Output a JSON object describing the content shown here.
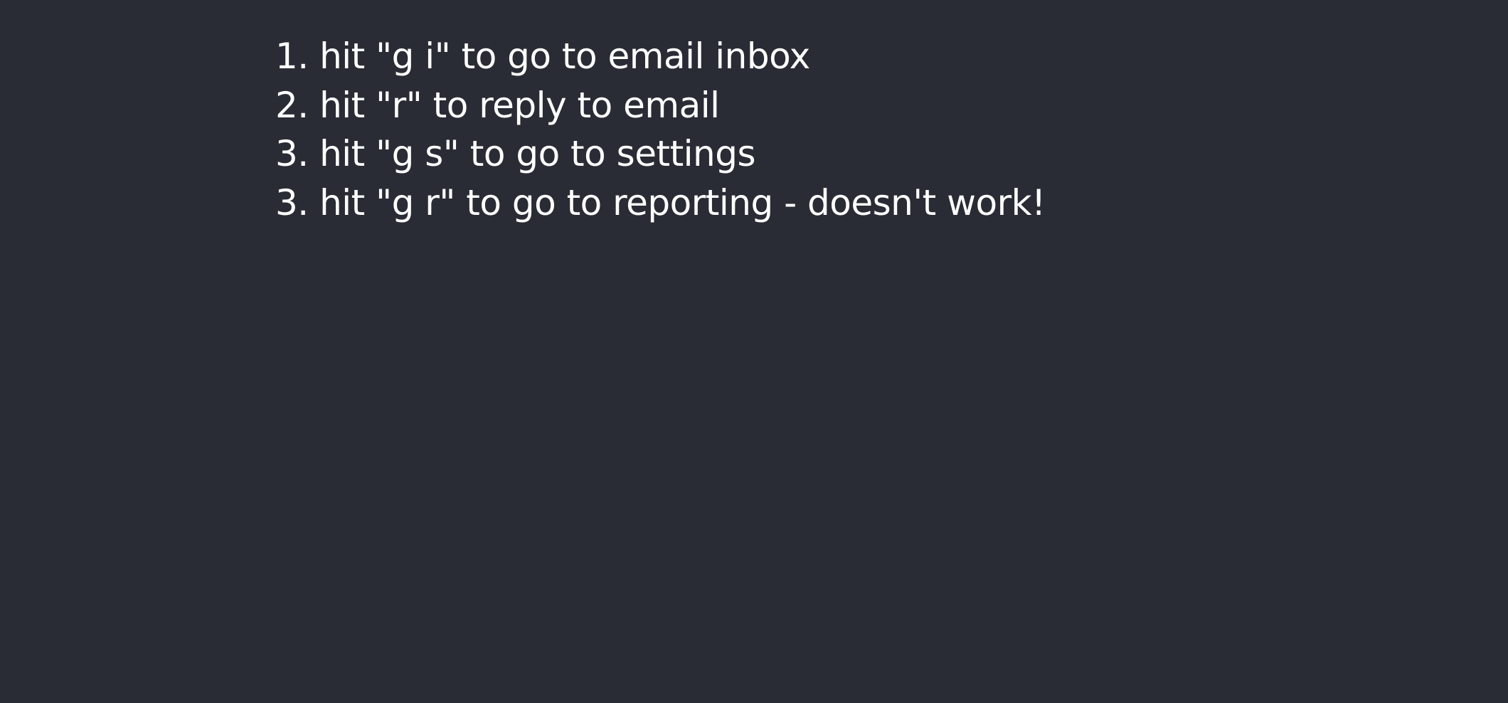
{
  "theme": {
    "background": "#292c34",
    "text_color": "#ffffff"
  },
  "instructions": [
    "1. hit \"g i\" to go to email inbox",
    "2. hit \"r\" to reply to email",
    "3. hit \"g s\" to go to settings",
    "3. hit \"g r\" to go to reporting - doesn't work!"
  ]
}
